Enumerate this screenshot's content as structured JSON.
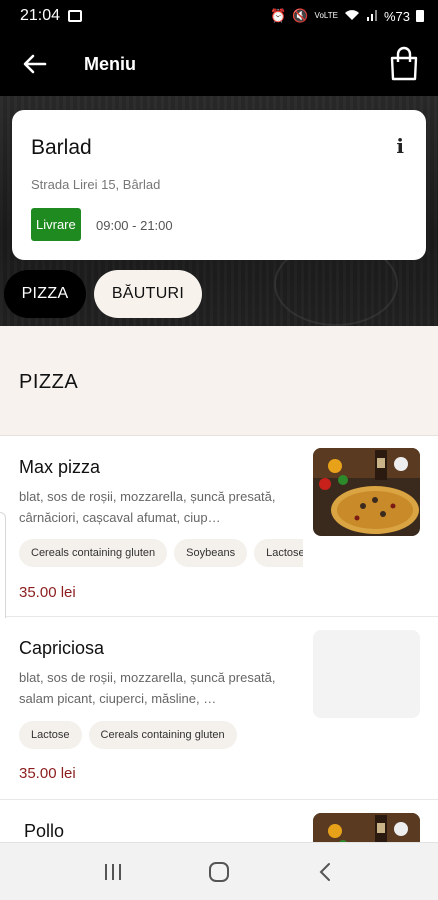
{
  "status_bar": {
    "time": "21:04",
    "battery": "%73",
    "network": "VoLTE"
  },
  "header": {
    "title": "Meniu"
  },
  "store": {
    "name": "Barlad",
    "address": "Strada Lirei 15, Bârlad",
    "delivery_badge": "Livrare",
    "hours": "09:00 - 21:00",
    "badge_color": "#1f8a1f"
  },
  "category_tabs": [
    {
      "label": "PIZZA",
      "selected": true
    },
    {
      "label": "BĂUTURI",
      "selected": false
    }
  ],
  "section": {
    "title": "PIZZA"
  },
  "products": [
    {
      "name": "Max pizza",
      "description": "blat, sos de roșii, mozzarella, șuncă presată, cârnăciori, cașcaval afumat, ciup…",
      "allergens": [
        "Cereals containing gluten",
        "Soybeans",
        "Lactose"
      ],
      "price": "35.00 lei",
      "has_image": true
    },
    {
      "name": "Capriciosa",
      "description": "blat, sos de roșii, mozzarella, șuncă presată, salam picant, ciuperci, măsline, …",
      "allergens": [
        "Lactose",
        "Cereals containing gluten"
      ],
      "price": "35.00 lei",
      "has_image": false
    },
    {
      "name": "Pollo",
      "has_image": true
    }
  ],
  "colors": {
    "price": "#8b1d1d",
    "accent_dark": "#000000",
    "section_bg": "#f7f2ee"
  }
}
